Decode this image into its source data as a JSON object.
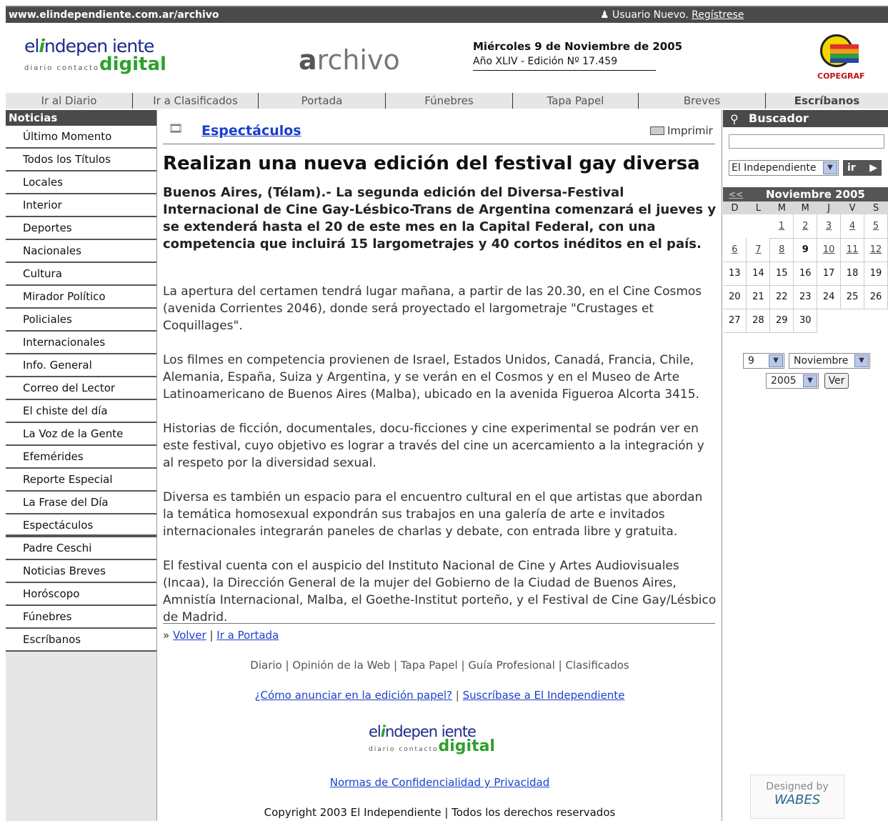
{
  "topbar": {
    "url": "www.elindependiente.com.ar/archivo",
    "user_text": "Usuario Nuevo.",
    "register": "Regístrese"
  },
  "header": {
    "logo_top": "el",
    "logo_i": "i",
    "logo_rest": "ndepen iente",
    "logo_sub": "diario contacto",
    "logo_digital": "digital",
    "archivo_a": "a",
    "archivo_rest": "rchivo",
    "date": "Miércoles 9 de Noviembre de 2005",
    "edition": "Año XLIV - Edición Nº 17.459",
    "sponsor": "COPEGRAF"
  },
  "nav": {
    "items": [
      "Ir al Diario",
      "Ir a Clasificados",
      "Portada",
      "Fúnebres",
      "Tapa Papel",
      "Breves",
      "Escríbanos"
    ]
  },
  "sidebar": {
    "title": "Noticias",
    "items": [
      "Último Momento",
      "Todos los Títulos",
      "Locales",
      "Interior",
      "Deportes",
      "Nacionales",
      "Cultura",
      "Mirador Político",
      "Policiales",
      "Internacionales",
      "Info. General",
      "Correo del Lector",
      "El chiste del día",
      "La Voz de la Gente",
      "Efemérides",
      "Reporte Especial",
      "La Frase del Día",
      "Espectáculos",
      "Padre Ceschi",
      "Noticias Breves",
      "Horóscopo",
      "Fúnebres",
      "Escríbanos"
    ]
  },
  "article": {
    "section": "Espectáculos",
    "print": "Imprimir",
    "headline": "Realizan una nueva edición del festival gay diversa",
    "lead": "Buenos Aires, (Télam).- La segunda edición del Diversa-Festival Internacional de Cine Gay-Lésbico-Trans de Argentina comenzará el jueves y se extenderá hasta el 20 de este mes en la Capital Federal, con una competencia que incluirá 15 largometrajes y 40 cortos inéditos en el país.",
    "paragraphs": [
      "La apertura del certamen tendrá lugar mañana, a partir de las 20.30, en el Cine Cosmos (avenida Corrientes 2046), donde será proyectado el largometraje \"Crustages et Coquillages\".",
      "Los filmes en competencia provienen de Israel, Estados Unidos, Canadá, Francia, Chile, Alemania, España, Suiza y Argentina, y se verán en el Cosmos y en el Museo de Arte Latinoamericano de Buenos Aires (Malba), ubicado en la avenida Figueroa Alcorta 3415.",
      "Historias de ficción, documentales, docu-ficciones y cine experimental se podrán ver en este festival, cuyo objetivo es lograr a través del cine un acercamiento a la integración y al respeto por la diversidad sexual.",
      "Diversa es también un espacio para el encuentro cultural en el que artistas que abordan la temática homosexual expondrán sus trabajos en una galería de arte e invitados internacionales integrarán paneles de charlas y debate, con entrada libre y gratuita.",
      "El festival cuenta con el auspicio del Instituto Nacional de Cine y Artes Audiovisuales (Incaa), la Dirección General de la mujer del Gobierno de la Ciudad de Buenos Aires, Amnistía Internacional, Malba, el Goethe-Institut porteño, y el Festival de Cine Gay/Lésbico de Madrid."
    ],
    "back_prefix": "»",
    "back": "Volver",
    "portada": "Ir a Portada"
  },
  "footer": {
    "links": [
      "Diario",
      "Opinión de la Web",
      "Tapa Papel",
      "Guía Profesional",
      "Clasificados"
    ],
    "advertise": "¿Cómo anunciar en la edición papel?",
    "subscribe": "Suscríbase a El Independiente",
    "privacy": "Normas de Confidencialidad y Privacidad",
    "copyright": "Copyright 2003 El Independiente | Todos los derechos reservados"
  },
  "search": {
    "title": "Buscador",
    "site_selected": "El Independiente",
    "go": "ir"
  },
  "calendar": {
    "prev": "<<",
    "month": "Noviembre 2005",
    "weekdays": [
      "D",
      "L",
      "M",
      "M",
      "J",
      "V",
      "S"
    ],
    "weeks": [
      [
        "",
        "",
        "1",
        "2",
        "3",
        "4",
        "5"
      ],
      [
        "6",
        "7",
        "8",
        "9",
        "10",
        "11",
        "12"
      ],
      [
        "13",
        "14",
        "15",
        "16",
        "17",
        "18",
        "19"
      ],
      [
        "20",
        "21",
        "22",
        "23",
        "24",
        "25",
        "26"
      ],
      [
        "27",
        "28",
        "29",
        "30",
        "",
        "",
        ""
      ]
    ],
    "day_selected": "9",
    "month_selected": "Noviembre",
    "year_selected": "2005",
    "ver": "Ver"
  },
  "designed": {
    "label": "Designed by",
    "brand": "WABES"
  }
}
